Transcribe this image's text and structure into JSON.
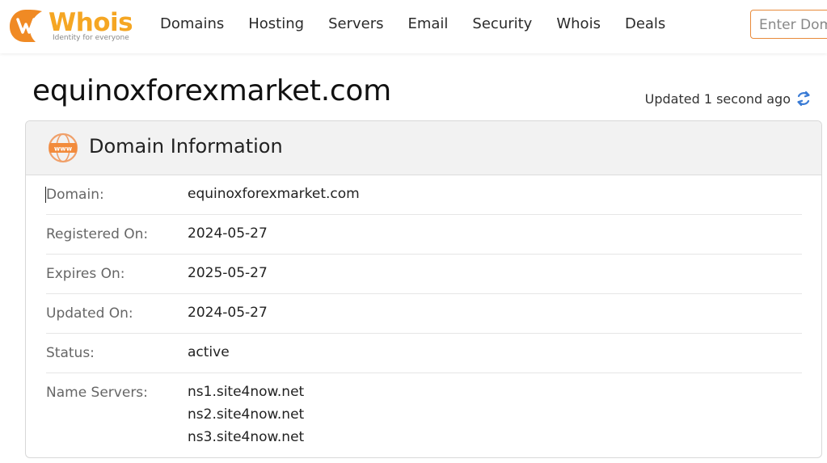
{
  "brand": {
    "name": "Whois",
    "tagline": "Identity for everyone",
    "accent_color": "#f5a623",
    "logo_icon": "whois-logo-mark"
  },
  "nav": {
    "items": [
      {
        "label": "Domains"
      },
      {
        "label": "Hosting"
      },
      {
        "label": "Servers"
      },
      {
        "label": "Email"
      },
      {
        "label": "Security"
      },
      {
        "label": "Whois"
      },
      {
        "label": "Deals"
      }
    ]
  },
  "search": {
    "placeholder": "Enter Domain"
  },
  "page": {
    "title": "equinoxforexmarket.com",
    "updated_text": "Updated 1 second ago",
    "refresh_icon": "refresh-icon"
  },
  "card": {
    "title": "Domain Information",
    "icon": "www-icon",
    "rows": [
      {
        "label": "Domain:",
        "value": "equinoxforexmarket.com"
      },
      {
        "label": "Registered On:",
        "value": "2024-05-27"
      },
      {
        "label": "Expires On:",
        "value": "2025-05-27"
      },
      {
        "label": "Updated On:",
        "value": "2024-05-27"
      },
      {
        "label": "Status:",
        "value": "active"
      },
      {
        "label": "Name Servers:",
        "values": [
          "ns1.site4now.net",
          "ns2.site4now.net",
          "ns3.site4now.net"
        ]
      }
    ]
  }
}
